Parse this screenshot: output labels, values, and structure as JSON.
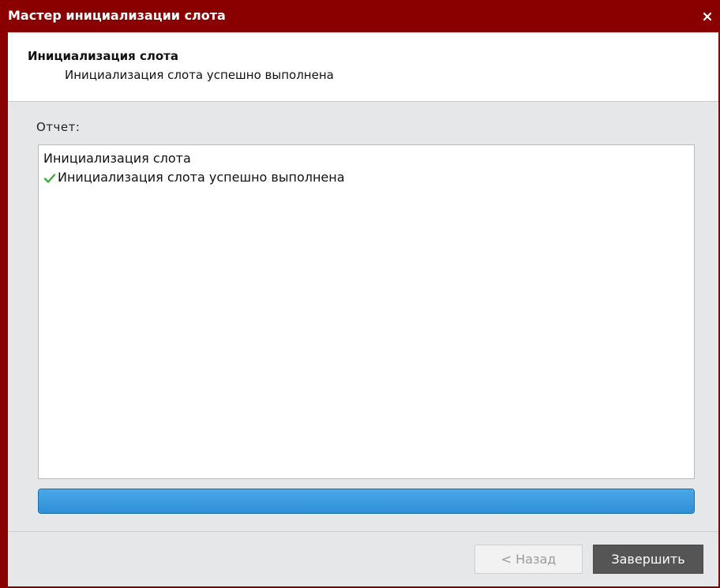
{
  "window": {
    "title": "Мастер инициализации слота",
    "border_color": "#8a0000"
  },
  "header": {
    "title": "Инициализация слота",
    "subtitle": "Инициализация слота успешно выполнена"
  },
  "report": {
    "label": "Отчет:",
    "lines": [
      {
        "text": "Инициализация слота",
        "icon": null
      },
      {
        "text": "Инициализация слота успешно выполнена",
        "icon": "check-icon",
        "icon_color": "#3cae3c"
      }
    ]
  },
  "progress": {
    "value_percent": 100,
    "color": "#2f8fd6"
  },
  "buttons": {
    "back_label": "< Назад",
    "back_enabled": false,
    "finish_label": "Завершить"
  }
}
